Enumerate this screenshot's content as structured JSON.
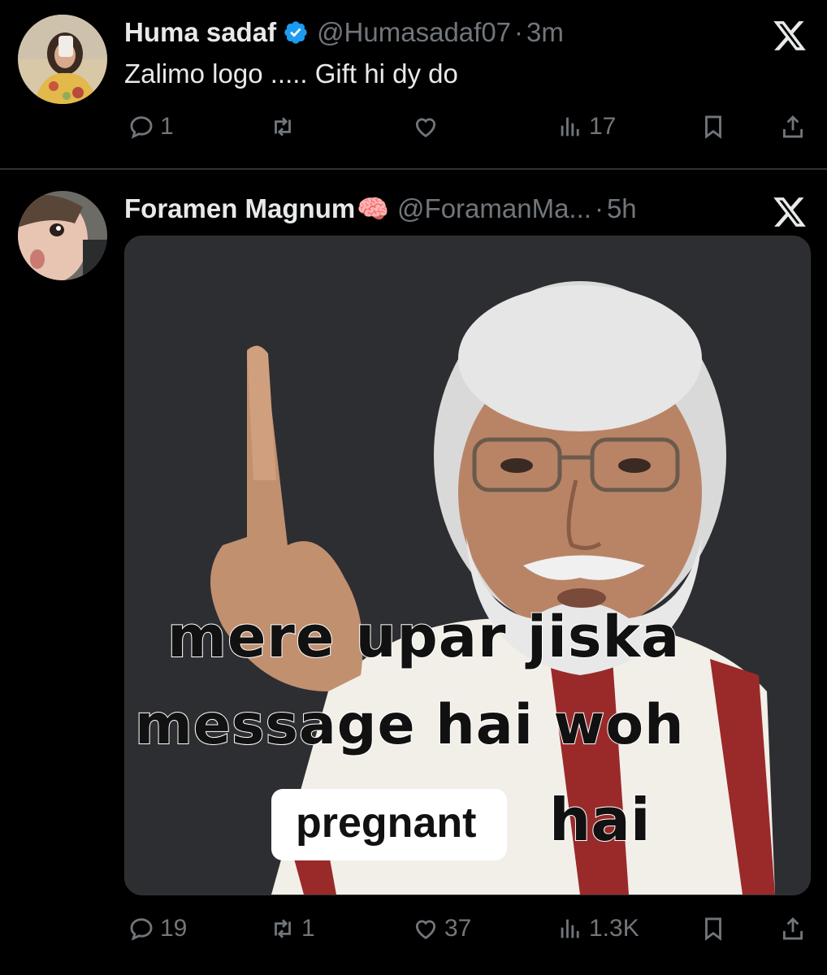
{
  "tweets": [
    {
      "name": "Huma sadaf",
      "verified": true,
      "handle": "@Humasadaf07",
      "time": "3m",
      "text": "Zalimo logo ..... Gift hi dy do",
      "replies": "1",
      "reposts": "",
      "likes": "",
      "views": "17"
    },
    {
      "name": "Foramen Magnum",
      "name_emoji": "🧠",
      "handle": "@ForamanMa...",
      "time": "5h",
      "media_caption": {
        "line1": "mere upar jiska",
        "line2": "message hai woh",
        "word_in_box": "pregnant",
        "last_word": "hai"
      },
      "replies": "19",
      "reposts": "1",
      "likes": "37",
      "views": "1.3K"
    }
  ],
  "separator": "·",
  "colors": {
    "background": "#000000",
    "text": "#e7e9ea",
    "muted": "#71767b",
    "verified": "#1d9bf0",
    "divider": "#2f3336"
  },
  "icons": [
    "reply-icon",
    "repost-icon",
    "like-icon",
    "views-icon",
    "bookmark-icon",
    "share-icon",
    "x-logo-icon",
    "verified-badge-icon"
  ]
}
